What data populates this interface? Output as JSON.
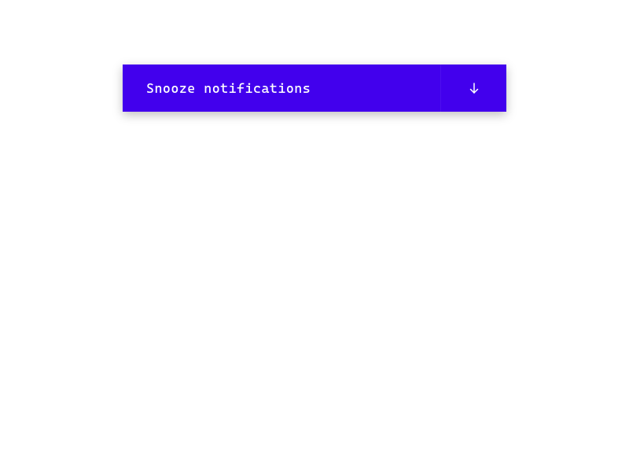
{
  "dropdown": {
    "label": "Snooze notifications",
    "icon": "arrow-down-icon",
    "colors": {
      "background": "#4200ed",
      "text": "#ffffff"
    }
  }
}
